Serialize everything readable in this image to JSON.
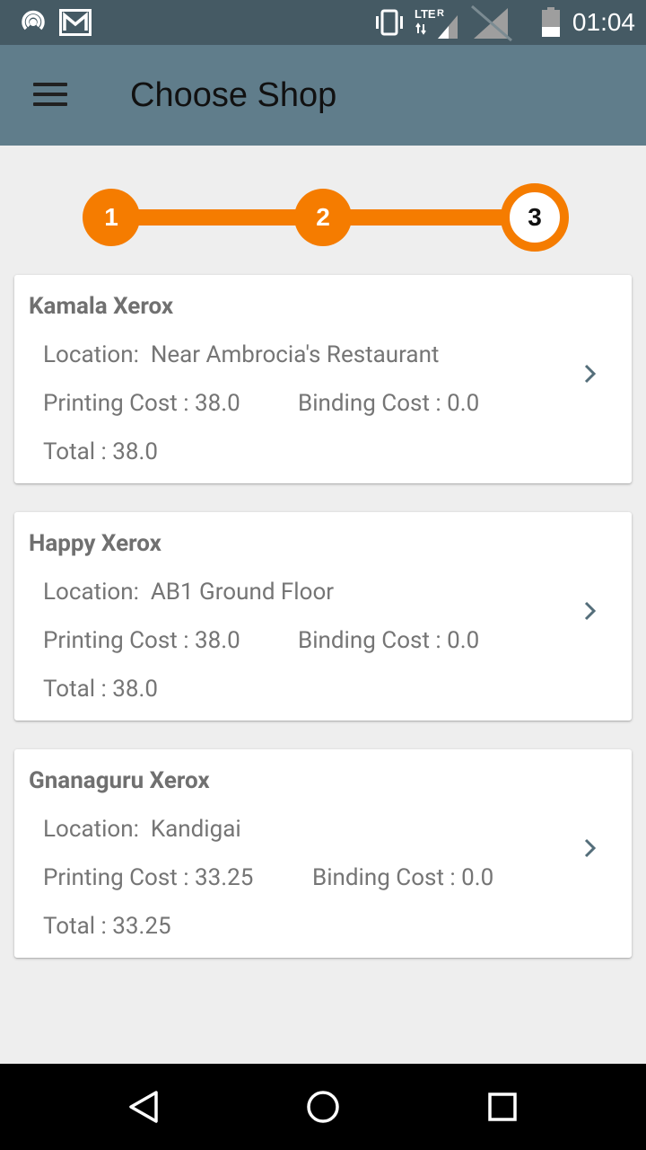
{
  "status_bar": {
    "time": "01:04",
    "icons": [
      "hotspot-icon",
      "gmail-icon",
      "vibrate-icon",
      "lte-signal-icon",
      "no-sim-signal-icon",
      "battery-icon"
    ],
    "network_label": "LTE",
    "roaming_label": "R"
  },
  "app_bar": {
    "title": "Choose Shop",
    "menu_icon": "hamburger-menu-icon"
  },
  "stepper": {
    "steps": [
      "1",
      "2",
      "3"
    ],
    "current_step": 3,
    "accent_color": "#f57c00"
  },
  "labels": {
    "location": "Location:",
    "printing_cost": "Printing Cost :",
    "binding_cost": "Binding Cost :",
    "total": "Total :"
  },
  "shops": [
    {
      "name": "Kamala Xerox",
      "location": "Near Ambrocia's Restaurant",
      "printing_cost": "38.0",
      "binding_cost": "0.0",
      "total": "38.0"
    },
    {
      "name": "Happy Xerox",
      "location": "AB1 Ground Floor",
      "printing_cost": "38.0",
      "binding_cost": "0.0",
      "total": "38.0"
    },
    {
      "name": "Gnanaguru Xerox",
      "location": "Kandigai",
      "printing_cost": "33.25",
      "binding_cost": "0.0",
      "total": "33.25"
    }
  ],
  "nav_bar": {
    "icons": [
      "back-icon",
      "home-icon",
      "recents-icon"
    ]
  },
  "colors": {
    "status_bar": "#455a64",
    "app_bar": "#607d8b",
    "background": "#eeeeee",
    "accent": "#f57c00"
  }
}
